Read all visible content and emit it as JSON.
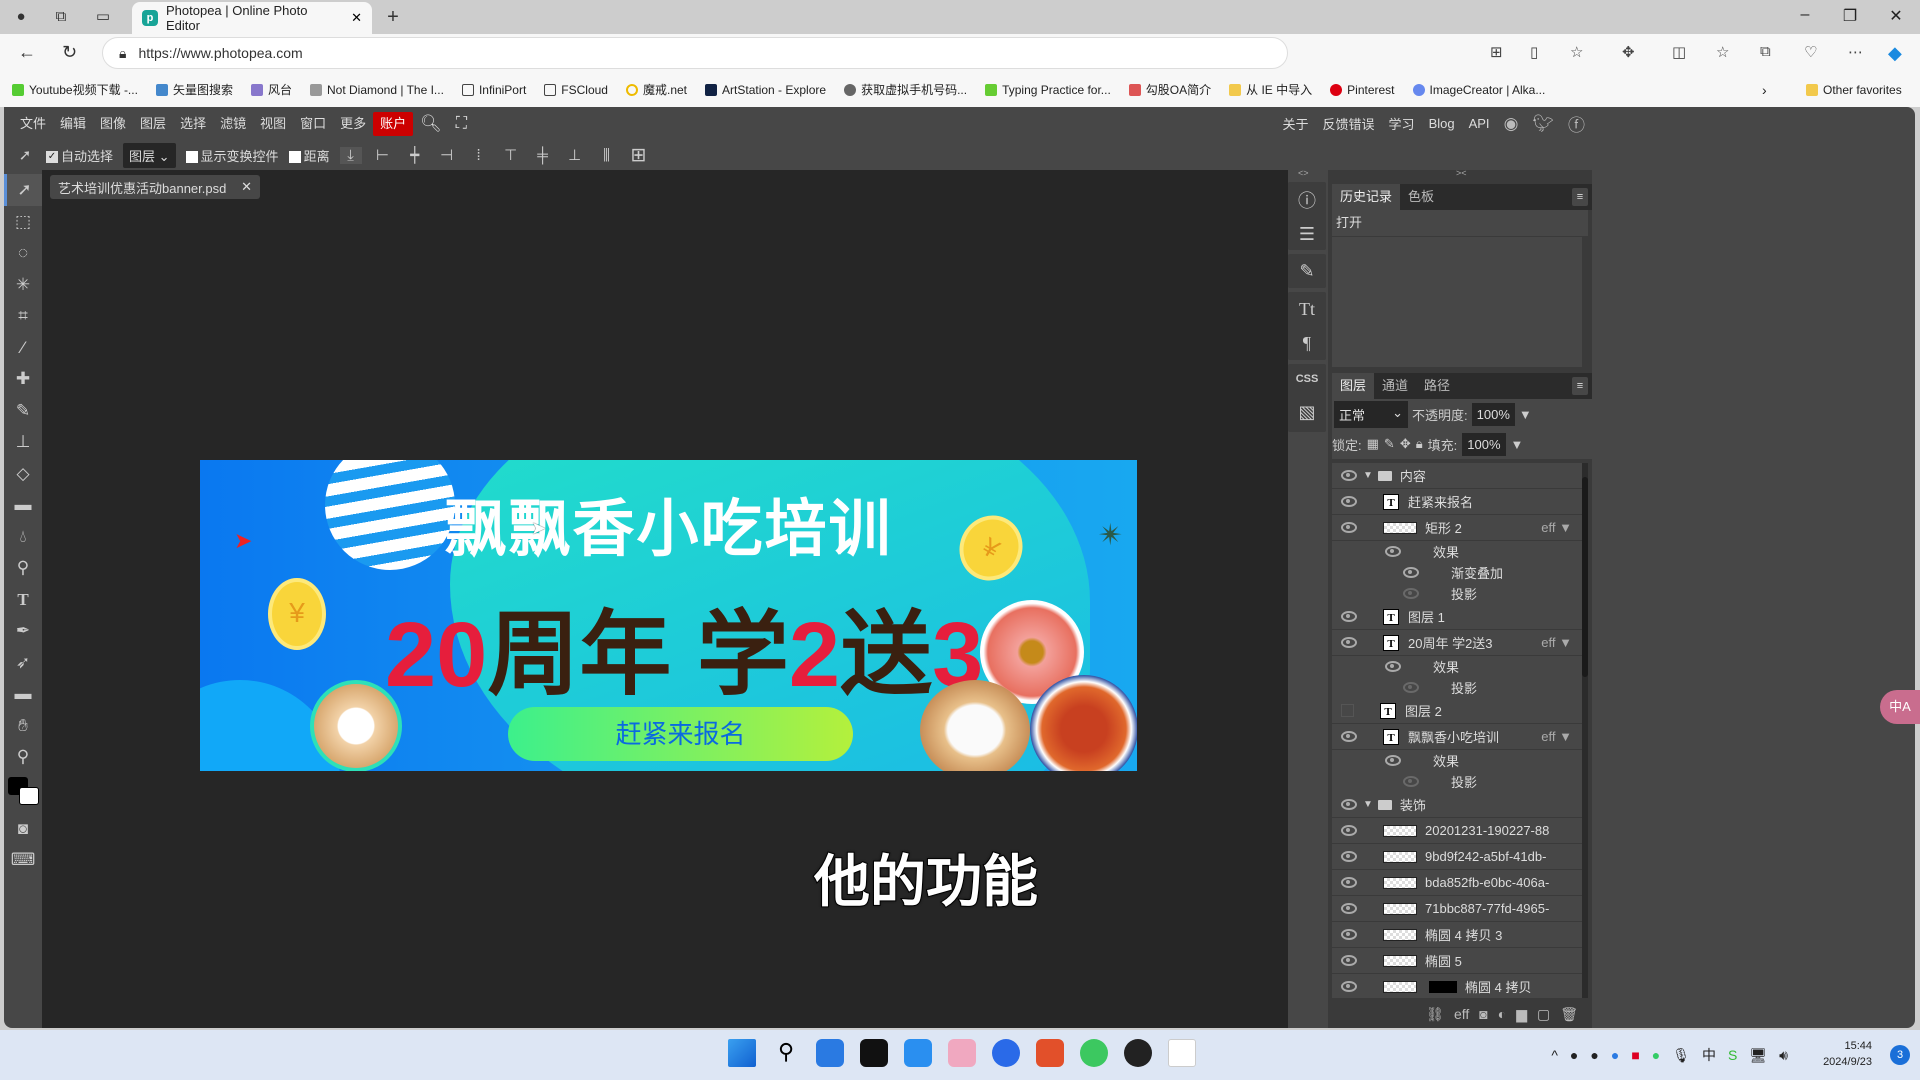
{
  "browser": {
    "tab_title": "Photopea | Online Photo Editor",
    "url": "https://www.photopea.com",
    "bookmarks": [
      "Youtube视频下载 -...",
      "矢量图搜索",
      "风台",
      "Not Diamond | The I...",
      "InfiniPort",
      "FSCloud",
      "魔戒.net",
      "ArtStation - Explore",
      "获取虚拟手机号码...",
      "Typing Practice for...",
      "勾股OA简介",
      "从 IE 中导入",
      "Pinterest",
      "ImageCreator | Alka..."
    ],
    "other_favorites": "Other favorites"
  },
  "menu": {
    "items": [
      "文件",
      "编辑",
      "图像",
      "图层",
      "选择",
      "滤镜",
      "视图",
      "窗口",
      "更多"
    ],
    "account": "账户",
    "right": [
      "关于",
      "反馈错误",
      "学习",
      "Blog",
      "API"
    ]
  },
  "options": {
    "auto_select": "自动选择",
    "auto_select_checked": true,
    "target": "图层",
    "show_transform": "显示变换控件",
    "distance": "距离"
  },
  "document": {
    "tab": "艺术培训优惠活动banner.psd"
  },
  "banner": {
    "title": "飘飘香小吃培训",
    "promo_a": "20",
    "promo_b": "周年 学",
    "promo_c": "2",
    "promo_d": "送",
    "promo_e": "3",
    "button": "赶紧来报名",
    "currency": "¥"
  },
  "subtitle": "他的功能",
  "history": {
    "tabs": [
      "历史记录",
      "色板"
    ],
    "items": [
      "打开"
    ]
  },
  "layers_panel": {
    "tabs": [
      "图层",
      "通道",
      "路径"
    ],
    "blend_mode": "正常",
    "opacity_label": "不透明度:",
    "opacity": "100%",
    "lock_label": "锁定:",
    "fill_label": "填充:",
    "fill": "100%",
    "layers": [
      {
        "name": "内容",
        "type": "group",
        "visible": true
      },
      {
        "name": "赶紧来报名",
        "type": "text",
        "visible": true
      },
      {
        "name": "矩形 2",
        "type": "shape",
        "visible": true,
        "eff": "eff"
      },
      {
        "name": "效果",
        "type": "fx",
        "visible": true
      },
      {
        "name": "渐变叠加",
        "type": "fx-item",
        "visible": true
      },
      {
        "name": "投影",
        "type": "fx-item",
        "visible": false
      },
      {
        "name": "图层 1",
        "type": "text",
        "visible": true
      },
      {
        "name": "20周年 学2送3",
        "type": "text",
        "visible": true,
        "eff": "eff"
      },
      {
        "name": "效果",
        "type": "fx",
        "visible": true
      },
      {
        "name": "投影",
        "type": "fx-item",
        "visible": false
      },
      {
        "name": "图层 2",
        "type": "text",
        "visible": false
      },
      {
        "name": "飘飘香小吃培训",
        "type": "text",
        "visible": true,
        "eff": "eff"
      },
      {
        "name": "效果",
        "type": "fx",
        "visible": true
      },
      {
        "name": "投影",
        "type": "fx-item",
        "visible": false
      },
      {
        "name": "装饰",
        "type": "group",
        "visible": true
      },
      {
        "name": "20201231-190227-88",
        "type": "smart",
        "visible": true
      },
      {
        "name": "9bd9f242-a5bf-41db-",
        "type": "smart",
        "visible": true
      },
      {
        "name": "bda852fb-e0bc-406a-",
        "type": "smart",
        "visible": true
      },
      {
        "name": "71bbc887-77fd-4965-",
        "type": "smart",
        "visible": true
      },
      {
        "name": "椭圆 4 拷贝 3",
        "type": "shape",
        "visible": true
      },
      {
        "name": "椭圆 5",
        "type": "shape",
        "visible": true
      },
      {
        "name": "椭圆 4 拷贝",
        "type": "shape-mask",
        "visible": true
      }
    ]
  },
  "translate_bubble": "中A",
  "taskbar": {
    "time": "15:44",
    "date": "2024/9/23",
    "notifications": "3"
  },
  "colors": {
    "accent_account": "#cc0000",
    "app_bg": "#474747",
    "canvas_bg": "#262626"
  }
}
